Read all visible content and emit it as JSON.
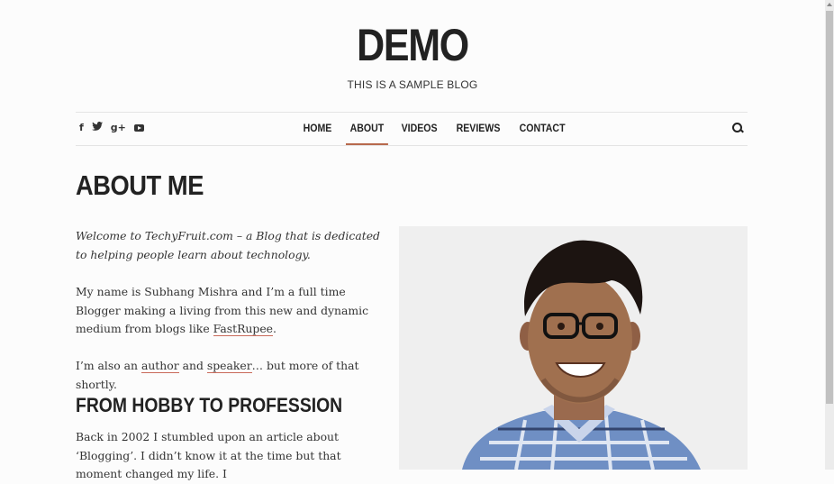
{
  "header": {
    "title": "DEMO",
    "tagline": "THIS IS A SAMPLE BLOG"
  },
  "social": {
    "icons": [
      "facebook-icon",
      "twitter-icon",
      "google-plus-icon",
      "youtube-icon"
    ]
  },
  "nav": {
    "items": [
      "HOME",
      "ABOUT",
      "VIDEOS",
      "REVIEWS",
      "CONTACT"
    ],
    "active": "ABOUT",
    "accent_color": "#b8694c"
  },
  "content": {
    "heading": "ABOUT ME",
    "intro": "Welcome to TechyFruit.com – a Blog that is dedicated to helping people learn about technology.",
    "p2_before": "My name is Subhang Mishra and I’m a full time Blogger making a living from this new and dynamic medium from blogs like ",
    "p2_link": "FastRupee",
    "p2_after": ".",
    "p3_before": "I’m also an ",
    "p3_link1": "author",
    "p3_mid": " and ",
    "p3_link2": "speaker",
    "p3_after": "… but more of that shortly.",
    "subheading": "FROM HOBBY TO PROFESSION",
    "p4": "Back in 2002 I stumbled upon an article about ‘Blogging’. I didn’t know it at the time but that moment changed my life. I"
  },
  "link_underline_color": "#c96a5a"
}
